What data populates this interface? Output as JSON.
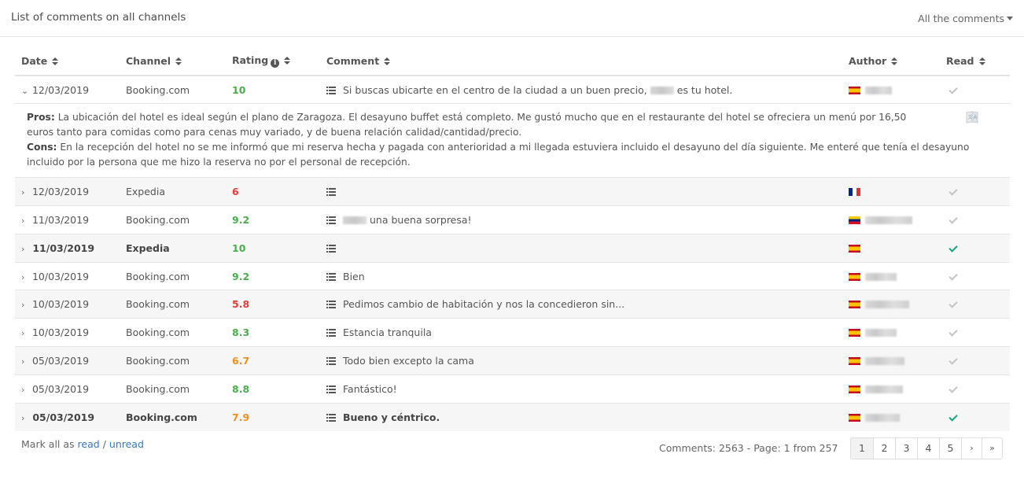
{
  "header": {
    "title": "List of comments on all channels",
    "filter_label": "All the comments"
  },
  "table": {
    "columns": {
      "date": "Date",
      "channel": "Channel",
      "rating": "Rating",
      "comment": "Comment",
      "author": "Author",
      "read": "Read"
    },
    "rating_colors": {
      "good": "#4cae4c",
      "medium": "#f0901f",
      "bad": "#e83a3a"
    },
    "rows": [
      {
        "date": "12/03/2019",
        "channel": "Booking.com",
        "rating": "10",
        "rating_level": "good",
        "comment_before": "Si buscas ubicarte en el centro de la ciudad a un buen precio,",
        "comment_after": "es tu hotel.",
        "has_blurred_name": true,
        "flag": "es",
        "flag_label": "Spain",
        "author_blurred": true,
        "read": false,
        "unread_bold": false,
        "expanded": true
      },
      {
        "date": "12/03/2019",
        "channel": "Expedia",
        "rating": "6",
        "rating_level": "bad",
        "comment_before": "",
        "comment_after": "",
        "has_blurred_name": false,
        "flag": "fr",
        "flag_label": "France",
        "author_blurred": false,
        "read": false,
        "unread_bold": false,
        "expanded": false
      },
      {
        "date": "11/03/2019",
        "channel": "Booking.com",
        "rating": "9.2",
        "rating_level": "good",
        "comment_before": "",
        "comment_after": "una buena sorpresa!",
        "has_blurred_name": true,
        "flag": "ve",
        "flag_label": "Venezuela",
        "author_blurred": true,
        "read": false,
        "unread_bold": false,
        "expanded": false
      },
      {
        "date": "11/03/2019",
        "channel": "Expedia",
        "rating": "10",
        "rating_level": "good",
        "comment_before": "",
        "comment_after": "",
        "has_blurred_name": false,
        "flag": "es",
        "flag_label": "Spain",
        "author_blurred": false,
        "read": true,
        "unread_bold": true,
        "expanded": false
      },
      {
        "date": "10/03/2019",
        "channel": "Booking.com",
        "rating": "9.2",
        "rating_level": "good",
        "comment_before": "Bien",
        "comment_after": "",
        "has_blurred_name": false,
        "flag": "es",
        "flag_label": "Spain",
        "author_blurred": true,
        "read": false,
        "unread_bold": false,
        "expanded": false
      },
      {
        "date": "10/03/2019",
        "channel": "Booking.com",
        "rating": "5.8",
        "rating_level": "bad",
        "comment_before": "Pedimos cambio de habitación y nos la concedieron sin...",
        "comment_after": "",
        "has_blurred_name": false,
        "flag": "es",
        "flag_label": "Spain",
        "author_blurred": true,
        "read": false,
        "unread_bold": false,
        "expanded": false
      },
      {
        "date": "10/03/2019",
        "channel": "Booking.com",
        "rating": "8.3",
        "rating_level": "good",
        "comment_before": "Estancia tranquila",
        "comment_after": "",
        "has_blurred_name": false,
        "flag": "es",
        "flag_label": "Spain",
        "author_blurred": true,
        "read": false,
        "unread_bold": false,
        "expanded": false
      },
      {
        "date": "05/03/2019",
        "channel": "Booking.com",
        "rating": "6.7",
        "rating_level": "medium",
        "comment_before": "Todo bien excepto la cama",
        "comment_after": "",
        "has_blurred_name": false,
        "flag": "es",
        "flag_label": "Spain",
        "author_blurred": true,
        "read": false,
        "unread_bold": false,
        "expanded": false
      },
      {
        "date": "05/03/2019",
        "channel": "Booking.com",
        "rating": "8.8",
        "rating_level": "good",
        "comment_before": "Fantástico!",
        "comment_after": "",
        "has_blurred_name": false,
        "flag": "es",
        "flag_label": "Spain",
        "author_blurred": true,
        "read": false,
        "unread_bold": false,
        "expanded": false
      },
      {
        "date": "05/03/2019",
        "channel": "Booking.com",
        "rating": "7.9",
        "rating_level": "medium",
        "comment_before": "Bueno y céntrico.",
        "comment_after": "",
        "has_blurred_name": false,
        "flag": "es",
        "flag_label": "Spain",
        "author_blurred": true,
        "read": true,
        "unread_bold": true,
        "expanded": false
      }
    ],
    "expanded_detail": {
      "pros_label": "Pros:",
      "pros_text": "La ubicación del hotel es ideal según el plano de Zaragoza. El desayuno buffet está completo. Me gustó mucho que en el restaurante del hotel se ofreciera un menú por 16,50 euros tanto para comidas como para cenas muy variado, y de buena relación calidad/cantidad/precio.",
      "cons_label": "Cons:",
      "cons_text": "En la recepción del hotel no se me informó que mi reserva hecha y pagada con anterioridad a mi llegada estuviera incluido el desayuno del día siguiente. Me enteré que tenía el desayuno incluido por la persona que me hizo la reserva no por el personal de recepción."
    }
  },
  "footer": {
    "mark_prefix": "Mark all as",
    "read_link": "read",
    "separator": "/",
    "unread_link": "unread",
    "count_text": "Comments: 2563 - Page: 1 from 257",
    "pages": [
      "1",
      "2",
      "3",
      "4",
      "5"
    ],
    "next_label": "›",
    "last_label": "»",
    "current_page": "1"
  },
  "icons": {
    "sort": "sort-icon",
    "info": "info-icon",
    "expand": "chevron-right-icon",
    "collapse": "chevron-down-icon",
    "comment_detail": "list-icon",
    "read_check": "check-icon",
    "translate": "translate-icon"
  },
  "glyphs": {
    "chevron_right": "›",
    "chevron_down": "⌄",
    "info": "i"
  }
}
